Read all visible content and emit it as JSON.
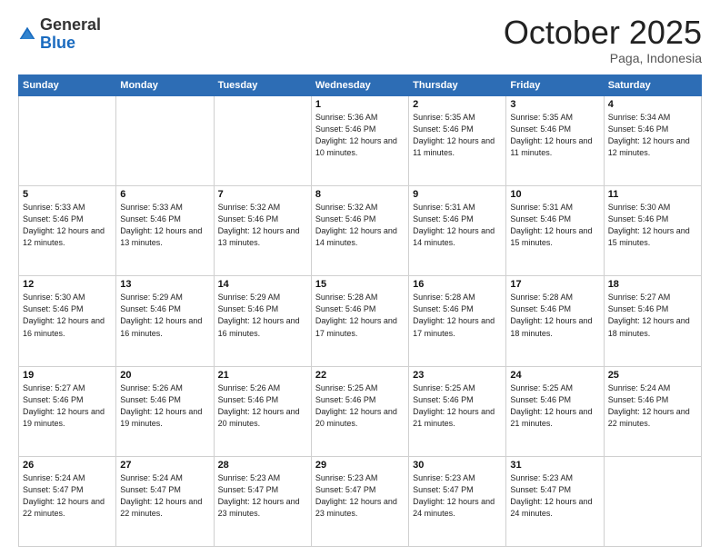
{
  "header": {
    "logo_general": "General",
    "logo_blue": "Blue",
    "month": "October 2025",
    "location": "Paga, Indonesia"
  },
  "weekdays": [
    "Sunday",
    "Monday",
    "Tuesday",
    "Wednesday",
    "Thursday",
    "Friday",
    "Saturday"
  ],
  "weeks": [
    [
      {
        "day": "",
        "sunrise": "",
        "sunset": "",
        "daylight": ""
      },
      {
        "day": "",
        "sunrise": "",
        "sunset": "",
        "daylight": ""
      },
      {
        "day": "",
        "sunrise": "",
        "sunset": "",
        "daylight": ""
      },
      {
        "day": "1",
        "sunrise": "Sunrise: 5:36 AM",
        "sunset": "Sunset: 5:46 PM",
        "daylight": "Daylight: 12 hours and 10 minutes."
      },
      {
        "day": "2",
        "sunrise": "Sunrise: 5:35 AM",
        "sunset": "Sunset: 5:46 PM",
        "daylight": "Daylight: 12 hours and 11 minutes."
      },
      {
        "day": "3",
        "sunrise": "Sunrise: 5:35 AM",
        "sunset": "Sunset: 5:46 PM",
        "daylight": "Daylight: 12 hours and 11 minutes."
      },
      {
        "day": "4",
        "sunrise": "Sunrise: 5:34 AM",
        "sunset": "Sunset: 5:46 PM",
        "daylight": "Daylight: 12 hours and 12 minutes."
      }
    ],
    [
      {
        "day": "5",
        "sunrise": "Sunrise: 5:33 AM",
        "sunset": "Sunset: 5:46 PM",
        "daylight": "Daylight: 12 hours and 12 minutes."
      },
      {
        "day": "6",
        "sunrise": "Sunrise: 5:33 AM",
        "sunset": "Sunset: 5:46 PM",
        "daylight": "Daylight: 12 hours and 13 minutes."
      },
      {
        "day": "7",
        "sunrise": "Sunrise: 5:32 AM",
        "sunset": "Sunset: 5:46 PM",
        "daylight": "Daylight: 12 hours and 13 minutes."
      },
      {
        "day": "8",
        "sunrise": "Sunrise: 5:32 AM",
        "sunset": "Sunset: 5:46 PM",
        "daylight": "Daylight: 12 hours and 14 minutes."
      },
      {
        "day": "9",
        "sunrise": "Sunrise: 5:31 AM",
        "sunset": "Sunset: 5:46 PM",
        "daylight": "Daylight: 12 hours and 14 minutes."
      },
      {
        "day": "10",
        "sunrise": "Sunrise: 5:31 AM",
        "sunset": "Sunset: 5:46 PM",
        "daylight": "Daylight: 12 hours and 15 minutes."
      },
      {
        "day": "11",
        "sunrise": "Sunrise: 5:30 AM",
        "sunset": "Sunset: 5:46 PM",
        "daylight": "Daylight: 12 hours and 15 minutes."
      }
    ],
    [
      {
        "day": "12",
        "sunrise": "Sunrise: 5:30 AM",
        "sunset": "Sunset: 5:46 PM",
        "daylight": "Daylight: 12 hours and 16 minutes."
      },
      {
        "day": "13",
        "sunrise": "Sunrise: 5:29 AM",
        "sunset": "Sunset: 5:46 PM",
        "daylight": "Daylight: 12 hours and 16 minutes."
      },
      {
        "day": "14",
        "sunrise": "Sunrise: 5:29 AM",
        "sunset": "Sunset: 5:46 PM",
        "daylight": "Daylight: 12 hours and 16 minutes."
      },
      {
        "day": "15",
        "sunrise": "Sunrise: 5:28 AM",
        "sunset": "Sunset: 5:46 PM",
        "daylight": "Daylight: 12 hours and 17 minutes."
      },
      {
        "day": "16",
        "sunrise": "Sunrise: 5:28 AM",
        "sunset": "Sunset: 5:46 PM",
        "daylight": "Daylight: 12 hours and 17 minutes."
      },
      {
        "day": "17",
        "sunrise": "Sunrise: 5:28 AM",
        "sunset": "Sunset: 5:46 PM",
        "daylight": "Daylight: 12 hours and 18 minutes."
      },
      {
        "day": "18",
        "sunrise": "Sunrise: 5:27 AM",
        "sunset": "Sunset: 5:46 PM",
        "daylight": "Daylight: 12 hours and 18 minutes."
      }
    ],
    [
      {
        "day": "19",
        "sunrise": "Sunrise: 5:27 AM",
        "sunset": "Sunset: 5:46 PM",
        "daylight": "Daylight: 12 hours and 19 minutes."
      },
      {
        "day": "20",
        "sunrise": "Sunrise: 5:26 AM",
        "sunset": "Sunset: 5:46 PM",
        "daylight": "Daylight: 12 hours and 19 minutes."
      },
      {
        "day": "21",
        "sunrise": "Sunrise: 5:26 AM",
        "sunset": "Sunset: 5:46 PM",
        "daylight": "Daylight: 12 hours and 20 minutes."
      },
      {
        "day": "22",
        "sunrise": "Sunrise: 5:25 AM",
        "sunset": "Sunset: 5:46 PM",
        "daylight": "Daylight: 12 hours and 20 minutes."
      },
      {
        "day": "23",
        "sunrise": "Sunrise: 5:25 AM",
        "sunset": "Sunset: 5:46 PM",
        "daylight": "Daylight: 12 hours and 21 minutes."
      },
      {
        "day": "24",
        "sunrise": "Sunrise: 5:25 AM",
        "sunset": "Sunset: 5:46 PM",
        "daylight": "Daylight: 12 hours and 21 minutes."
      },
      {
        "day": "25",
        "sunrise": "Sunrise: 5:24 AM",
        "sunset": "Sunset: 5:46 PM",
        "daylight": "Daylight: 12 hours and 22 minutes."
      }
    ],
    [
      {
        "day": "26",
        "sunrise": "Sunrise: 5:24 AM",
        "sunset": "Sunset: 5:47 PM",
        "daylight": "Daylight: 12 hours and 22 minutes."
      },
      {
        "day": "27",
        "sunrise": "Sunrise: 5:24 AM",
        "sunset": "Sunset: 5:47 PM",
        "daylight": "Daylight: 12 hours and 22 minutes."
      },
      {
        "day": "28",
        "sunrise": "Sunrise: 5:23 AM",
        "sunset": "Sunset: 5:47 PM",
        "daylight": "Daylight: 12 hours and 23 minutes."
      },
      {
        "day": "29",
        "sunrise": "Sunrise: 5:23 AM",
        "sunset": "Sunset: 5:47 PM",
        "daylight": "Daylight: 12 hours and 23 minutes."
      },
      {
        "day": "30",
        "sunrise": "Sunrise: 5:23 AM",
        "sunset": "Sunset: 5:47 PM",
        "daylight": "Daylight: 12 hours and 24 minutes."
      },
      {
        "day": "31",
        "sunrise": "Sunrise: 5:23 AM",
        "sunset": "Sunset: 5:47 PM",
        "daylight": "Daylight: 12 hours and 24 minutes."
      },
      {
        "day": "",
        "sunrise": "",
        "sunset": "",
        "daylight": ""
      }
    ]
  ]
}
